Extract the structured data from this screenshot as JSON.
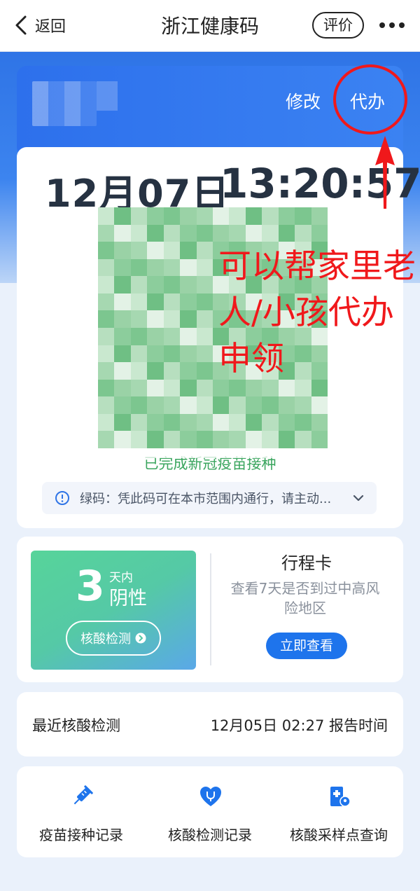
{
  "nav": {
    "back_label": "返回",
    "title": "浙江健康码",
    "rate_label": "评价"
  },
  "header": {
    "modify_label": "修改",
    "proxy_label": "代办"
  },
  "code": {
    "date": "12月07日",
    "time": "13:20:57",
    "vaccination_status": "已完成新冠疫苗接种",
    "notice": "绿码：凭此码可在本市范围内通行，请主动..."
  },
  "annotation": {
    "text": "可以帮家里老人/小孩代办申领"
  },
  "test": {
    "days": "3",
    "unit": "天内",
    "result": "阴性",
    "button_label": "核酸检测"
  },
  "travel": {
    "title": "行程卡",
    "desc": "查看7天是否到过中高风险地区",
    "button_label": "立即查看"
  },
  "recent": {
    "label": "最近核酸检测",
    "value": "12月05日 02:27 报告时间"
  },
  "links": [
    {
      "label": "疫苗接种记录",
      "icon": "vaccine-syringe-icon"
    },
    {
      "label": "核酸检测记录",
      "icon": "stethoscope-heart-icon"
    },
    {
      "label": "核酸采样点查询",
      "icon": "clinic-location-icon"
    }
  ],
  "colors": {
    "brand_blue": "#2f74e6",
    "annotation_red": "#f0181b",
    "green_code": "#57d49a",
    "button_blue": "#1e74ec"
  }
}
